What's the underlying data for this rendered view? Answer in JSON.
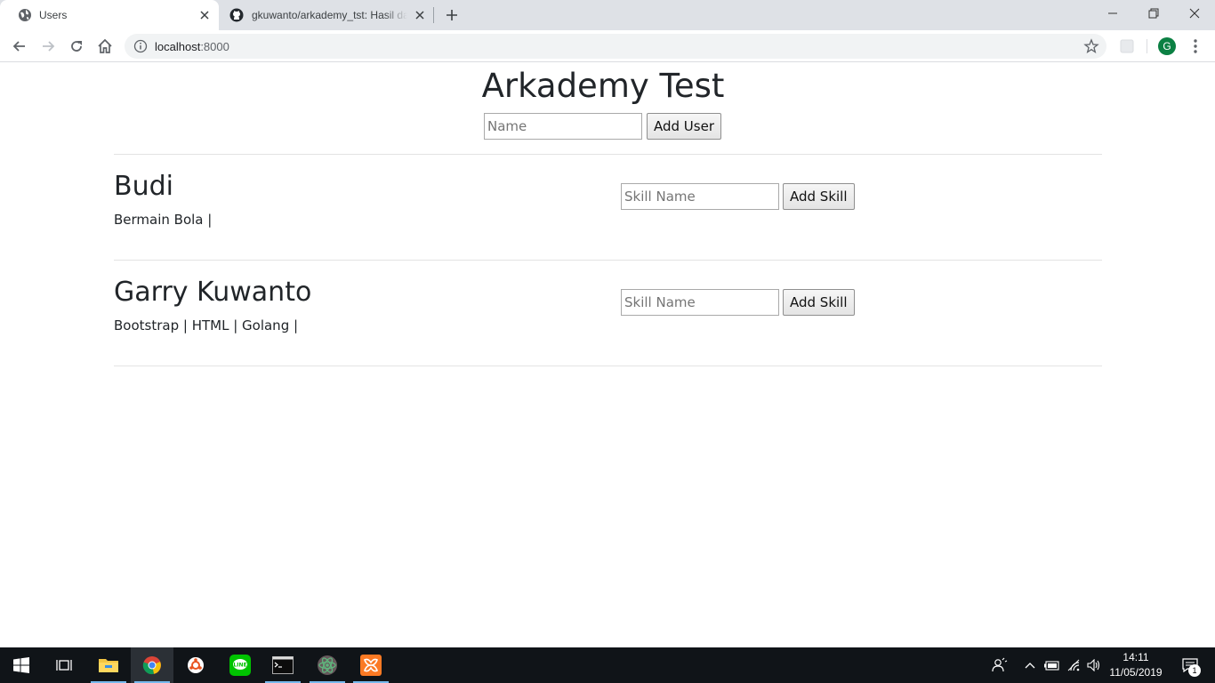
{
  "browser": {
    "tabs": [
      {
        "title": "Users",
        "active": true
      },
      {
        "title": "gkuwanto/arkademy_tst: Hasil dari",
        "active": false
      }
    ],
    "address": {
      "host": "localhost",
      "port": ":8000"
    },
    "profile_initial": "G"
  },
  "page": {
    "title": "Arkademy Test",
    "add_user": {
      "placeholder": "Name",
      "button": "Add User"
    },
    "users": [
      {
        "name": "Budi",
        "skills": "Bermain Bola |",
        "skill_placeholder": "Skill Name",
        "skill_button": "Add Skill"
      },
      {
        "name": "Garry Kuwanto",
        "skills": "Bootstrap | HTML | Golang |",
        "skill_placeholder": "Skill Name",
        "skill_button": "Add Skill"
      }
    ]
  },
  "taskbar": {
    "apps": [
      "windows-start",
      "task-view",
      "file-explorer",
      "chrome",
      "ubuntu",
      "line",
      "terminal",
      "atom",
      "xampp"
    ],
    "time": "14:11",
    "date": "11/05/2019",
    "notification_count": "1"
  },
  "colors": {
    "accent_profile": "#0b8043",
    "taskbar": "#101418",
    "tab_strip": "#dee1e6"
  }
}
